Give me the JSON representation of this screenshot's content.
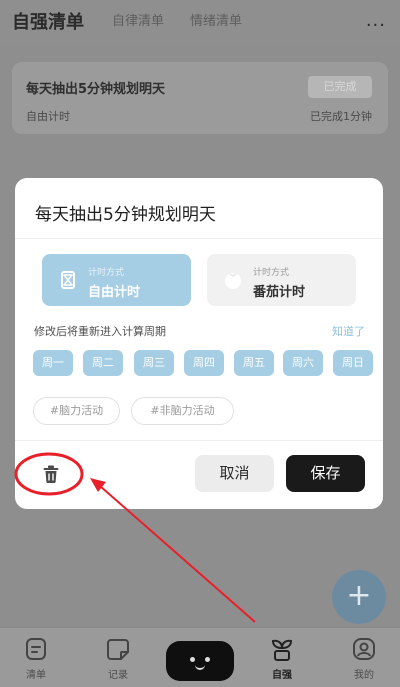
{
  "header": {
    "tabs": [
      {
        "label": "自强清单",
        "active": true
      },
      {
        "label": "自律清单",
        "active": false
      },
      {
        "label": "情绪清单",
        "active": false
      }
    ],
    "more_glyph": "..."
  },
  "task_card": {
    "title": "每天抽出5分钟规划明天",
    "badge": "已完成",
    "mode": "自由计时",
    "done_text": "已完成1分钟"
  },
  "modal": {
    "title": "每天抽出5分钟规划明天",
    "modes": [
      {
        "caption": "计时方式",
        "label": "自由计时",
        "selected": true,
        "icon": "hourglass-icon"
      },
      {
        "caption": "计时方式",
        "label": "番茄计时",
        "selected": false,
        "icon": "tomato-icon"
      }
    ],
    "hint": "修改后将重新进入计算周期",
    "hint_link": "知道了",
    "days": [
      "周一",
      "周二",
      "周三",
      "周四",
      "周五",
      "周六",
      "周日"
    ],
    "tags": [
      "#脑力活动",
      "#非脑力活动"
    ],
    "cancel_label": "取消",
    "save_label": "保存"
  },
  "fab": {
    "glyph": "+"
  },
  "bottom_nav": [
    {
      "label": "清单",
      "icon": "list-icon",
      "active": false
    },
    {
      "label": "记录",
      "icon": "record-icon",
      "active": false
    },
    {
      "label": "自强",
      "icon": "sprout-icon",
      "active": true
    },
    {
      "label": "我的",
      "icon": "profile-icon",
      "active": false
    }
  ],
  "colors": {
    "accent": "#a5cde3",
    "annotation": "#e8202a",
    "save_button": "#1a1a1a"
  }
}
